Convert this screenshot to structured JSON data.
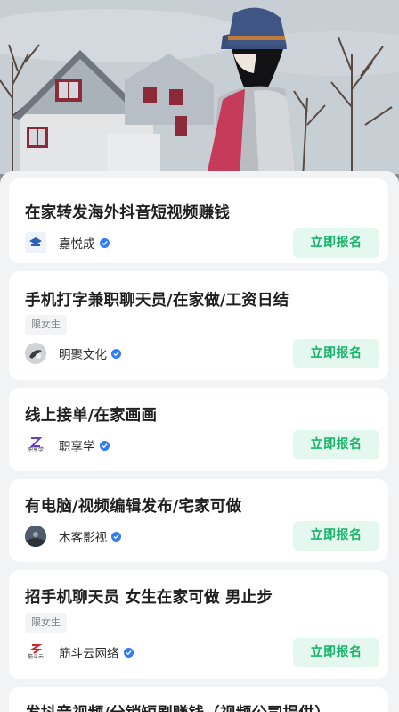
{
  "jobs": [
    {
      "title": "在家转发海外抖音短视频赚钱",
      "tag": "",
      "company": "嘉悦成",
      "logo_icon": "jiayue-logo-icon",
      "apply_label": "立即报名"
    },
    {
      "title": "手机打字兼职聊天员/在家做/工资日结",
      "tag": "限女生",
      "company": "明聚文化",
      "logo_icon": "mingju-logo-icon",
      "apply_label": "立即报名"
    },
    {
      "title": "线上接单/在家画画",
      "tag": "",
      "company": "职享学",
      "logo_icon": "zhixiangxue-logo-icon",
      "logo_text": "职享学",
      "apply_label": "立即报名"
    },
    {
      "title": "有电脑/视频编辑发布/宅家可做",
      "tag": "",
      "company": "木客影视",
      "logo_icon": "muke-logo-icon",
      "apply_label": "立即报名"
    },
    {
      "title": "招手机聊天员 女生在家可做 男止步",
      "tag": "限女生",
      "company": "筋斗云网络",
      "logo_icon": "jindouyun-logo-icon",
      "logo_text": "筋斗云",
      "apply_label": "立即报名"
    },
    {
      "title": "发抖音视频/分销短剧赚钱（视频公司提供）"
    }
  ],
  "colors": {
    "accent_green": "#19b46b",
    "button_bg": "#e5f8ef",
    "verified_blue": "#2f7cf6",
    "tag_bg": "#f3f4f6"
  }
}
